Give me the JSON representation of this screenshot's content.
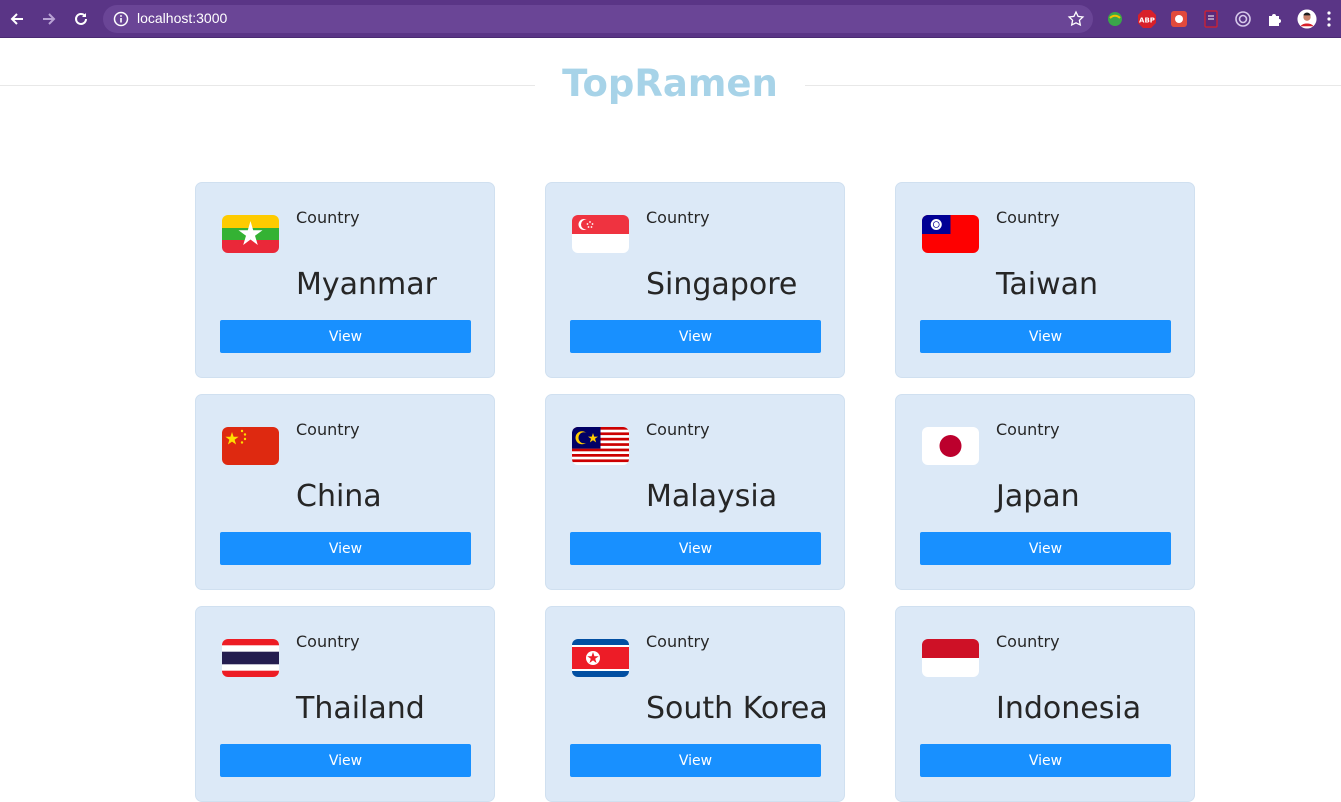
{
  "browser": {
    "url": "localhost:3000",
    "accent": "#5a3586",
    "extensions": [
      "globe-ext-icon",
      "abp-icon",
      "dino-ext-icon",
      "doc-ext-icon",
      "target-ext-icon",
      "puzzle-icon",
      "avatar"
    ],
    "abp_label": "ABP"
  },
  "header": {
    "title": "TopRamen",
    "title_color": "#a7d3e8"
  },
  "cards": [
    {
      "label": "Country",
      "name": "Myanmar",
      "button": "View",
      "flag": "flag-myanmar-icon"
    },
    {
      "label": "Country",
      "name": "Singapore",
      "button": "View",
      "flag": "flag-singapore-icon"
    },
    {
      "label": "Country",
      "name": "Taiwan",
      "button": "View",
      "flag": "flag-taiwan-icon"
    },
    {
      "label": "Country",
      "name": "China",
      "button": "View",
      "flag": "flag-china-icon"
    },
    {
      "label": "Country",
      "name": "Malaysia",
      "button": "View",
      "flag": "flag-malaysia-icon"
    },
    {
      "label": "Country",
      "name": "Japan",
      "button": "View",
      "flag": "flag-japan-icon"
    },
    {
      "label": "Country",
      "name": "Thailand",
      "button": "View",
      "flag": "flag-thailand-icon"
    },
    {
      "label": "Country",
      "name": "South Korea",
      "button": "View",
      "flag": "flag-south-korea-icon"
    },
    {
      "label": "Country",
      "name": "Indonesia",
      "button": "View",
      "flag": "flag-indonesia-icon"
    }
  ],
  "colors": {
    "card_bg": "#dce9f7",
    "button_bg": "#1890ff"
  }
}
